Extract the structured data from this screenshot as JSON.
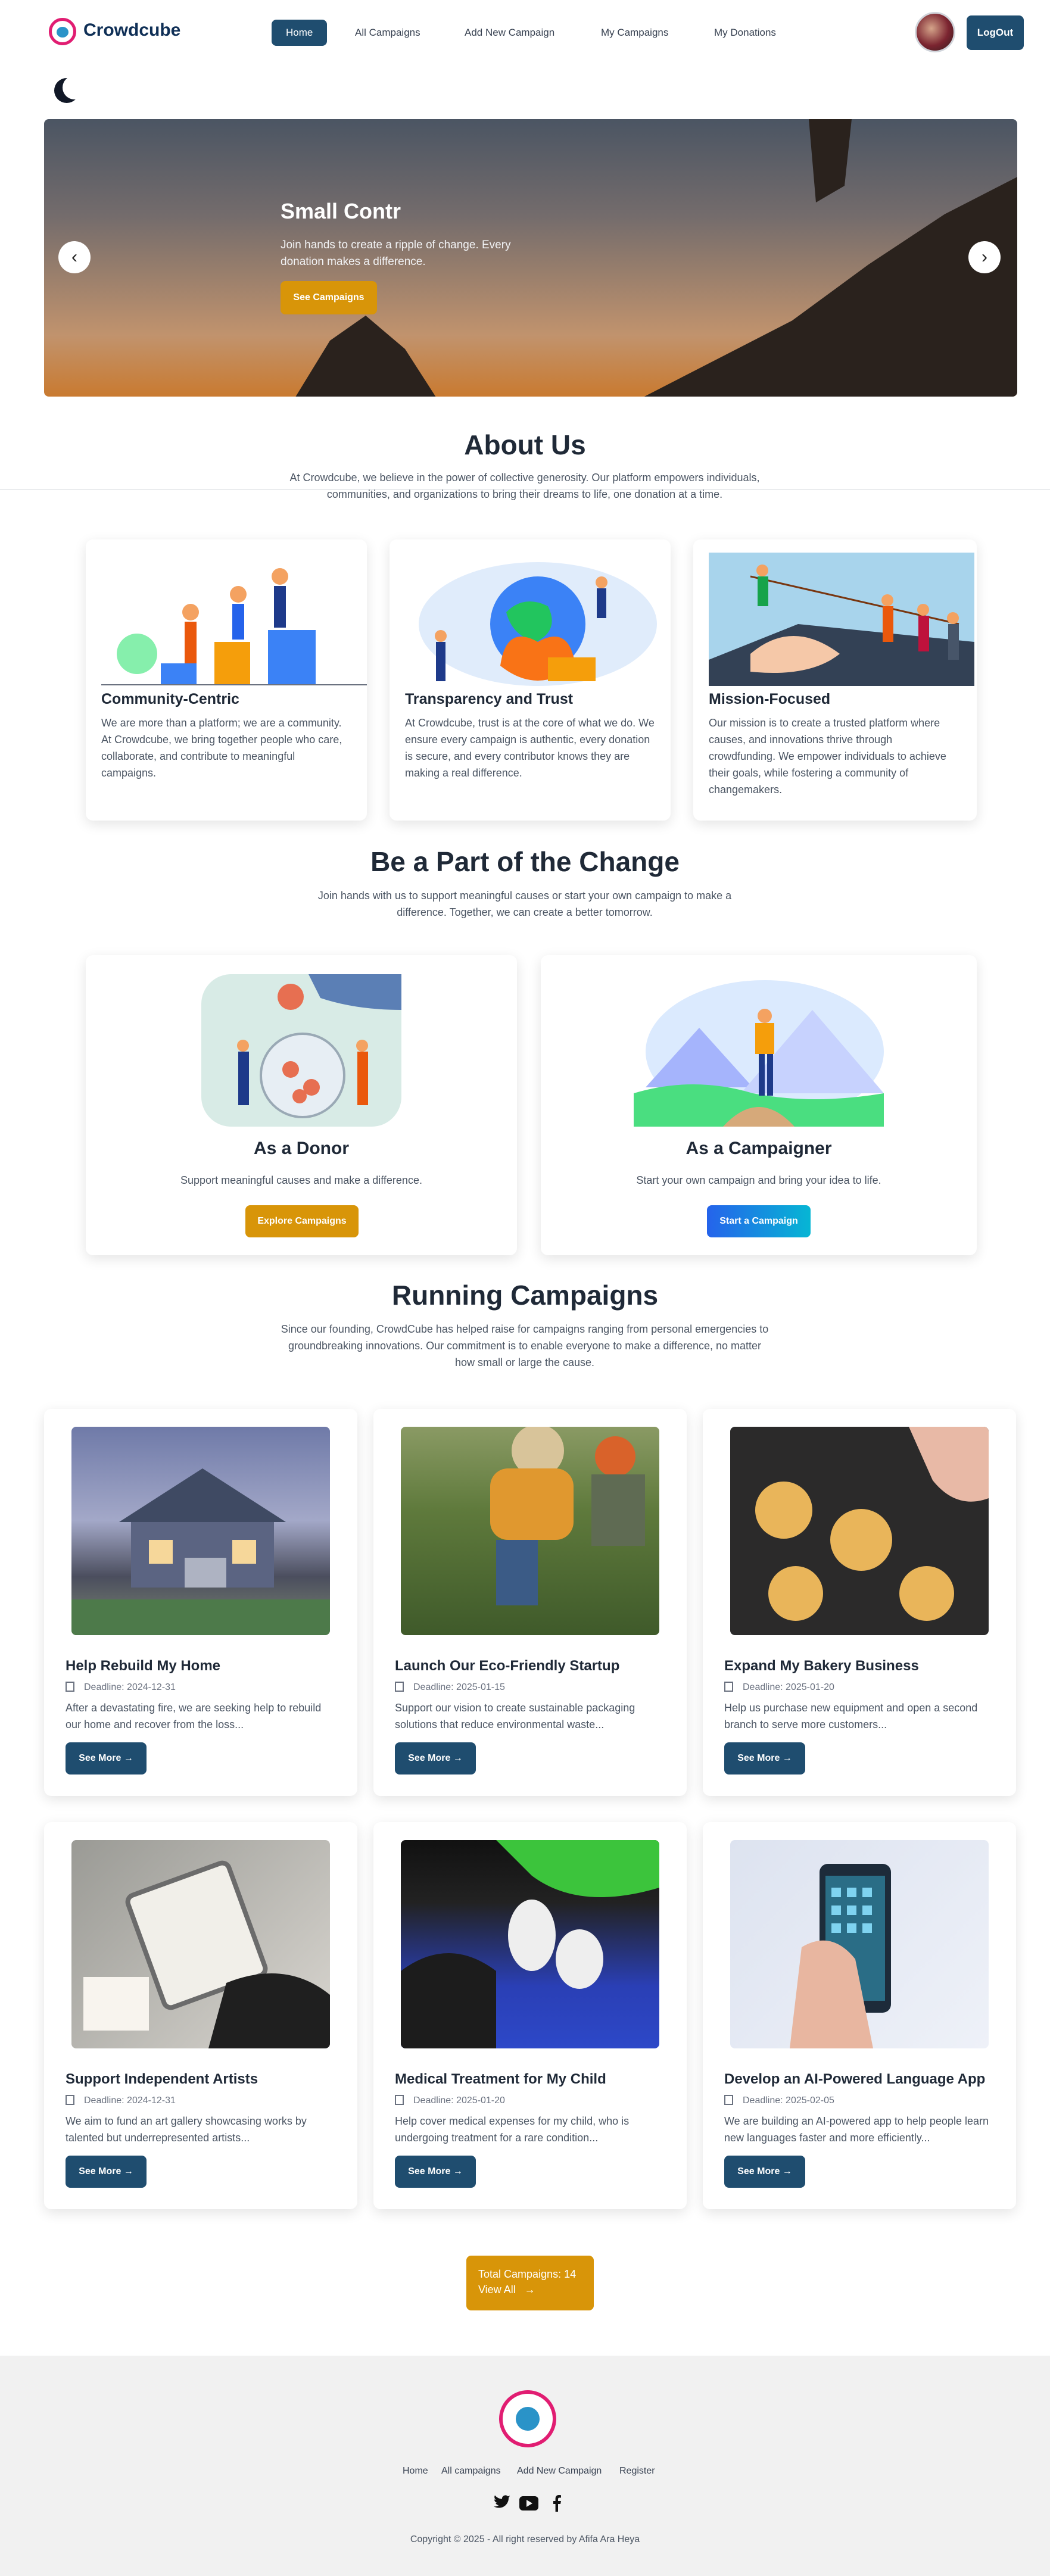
{
  "nav": {
    "brand": "Crowdcube",
    "items": [
      "Home",
      "All Campaigns",
      "Add New Campaign",
      "My Campaigns",
      "My Donations"
    ],
    "logout": "LogOut"
  },
  "hero": {
    "title": "Small Contr",
    "subtitle": "Join hands to create a ripple of change. Every donation makes a difference.",
    "cta": "See Campaigns",
    "prev_icon": "‹",
    "next_icon": "›"
  },
  "about": {
    "title": "About Us",
    "intro": "At Crowdcube, we believe in the power of collective generosity. Our platform empowers individuals, communities, and organizations to bring their dreams to life, one donation at a time.",
    "cards": [
      {
        "title": "Community-Centric",
        "text": "We are more than a platform; we are a community. At Crowdcube, we bring together people who care, collaborate, and contribute to meaningful campaigns."
      },
      {
        "title": "Transparency and Trust",
        "text": "At Crowdcube, trust is at the core of what we do. We ensure every campaign is authentic, every donation is secure, and every contributor knows they are making a real difference."
      },
      {
        "title": "Mission-Focused",
        "text": "Our mission is to create a trusted platform where causes, and innovations thrive through crowdfunding. We empower individuals to achieve their goals, while fostering a community of changemakers."
      }
    ]
  },
  "change": {
    "title": "Be a Part of the Change",
    "intro": "Join hands with us to support meaningful causes or start your own campaign to make a difference. Together, we can create a better tomorrow.",
    "donor": {
      "title": "As a Donor",
      "text": "Support meaningful causes and make a difference.",
      "button": "Explore Campaigns"
    },
    "campaigner": {
      "title": "As a Campaigner",
      "text": "Start your own campaign and bring your idea to life.",
      "button": "Start a Campaign"
    }
  },
  "running": {
    "title": "Running Campaigns",
    "intro": "Since our founding, CrowdCube has helped raise for campaigns ranging from personal emergencies to groundbreaking innovations. Our commitment is to enable everyone to make a difference, no matter how small or large the cause.",
    "campaigns": [
      {
        "title": "Help Rebuild My Home",
        "deadline": "Deadline: 2024-12-31",
        "desc": "After a devastating fire, we are seeking help to rebuild our home and recover from the loss...",
        "button": "See More"
      },
      {
        "title": "Launch Our Eco-Friendly Startup",
        "deadline": "Deadline: 2025-01-15",
        "desc": "Support our vision to create sustainable packaging solutions that reduce environmental waste...",
        "button": "See More"
      },
      {
        "title": "Expand My Bakery Business",
        "deadline": "Deadline: 2025-01-20",
        "desc": "Help us purchase new equipment and open a second branch to serve more customers...",
        "button": "See More"
      },
      {
        "title": "Support Independent Artists",
        "deadline": "Deadline: 2024-12-31",
        "desc": "We aim to fund an art gallery showcasing works by talented but underrepresented artists...",
        "button": "See More"
      },
      {
        "title": "Medical Treatment for My Child",
        "deadline": "Deadline: 2025-01-20",
        "desc": "Help cover medical expenses for my child, who is undergoing treatment for a rare condition...",
        "button": "See More"
      },
      {
        "title": "Develop an AI-Powered Language App",
        "deadline": "Deadline: 2025-02-05",
        "desc": "We are building an AI-powered app to help people learn new languages faster and more efficiently...",
        "button": "See More"
      }
    ],
    "total_line": "Total Campaigns: 14",
    "view_all": "View All"
  },
  "footer": {
    "links": [
      "Home",
      "All campaigns",
      "Add New Campaign",
      "Register"
    ],
    "social_icons": [
      "twitter-icon",
      "youtube-icon",
      "facebook-icon"
    ],
    "copyright": "Copyright © 2025 - All right reserved by Afifa Ara Heya"
  },
  "colors": {
    "primary": "#1f4d6f",
    "accent": "#d89509",
    "blue": "#2563eb"
  }
}
